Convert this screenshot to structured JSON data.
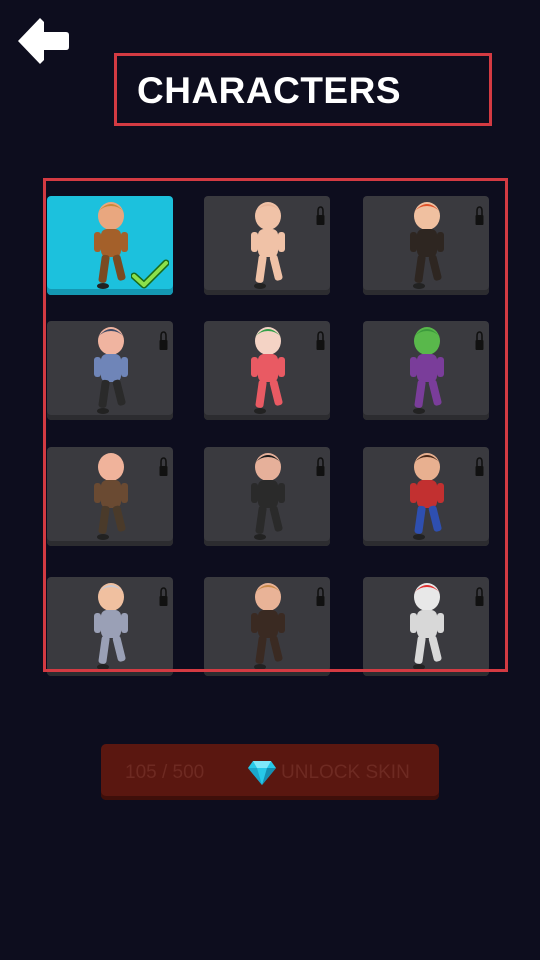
{
  "header": {
    "back_icon": "back-arrow-icon",
    "title": "CHARACTERS"
  },
  "characters": [
    {
      "name": "cowboy",
      "selected": true,
      "locked": false,
      "hair": "#c98a3a",
      "skin": "#e9a77f",
      "body": "#a4602a",
      "legs": "#7a4a22"
    },
    {
      "name": "baby",
      "selected": false,
      "locked": true,
      "hair": "#e9b69a",
      "skin": "#f0c2a7",
      "body": "#f0c2a7",
      "legs": "#f0c2a7"
    },
    {
      "name": "red-hair-agent",
      "selected": false,
      "locked": true,
      "hair": "#e0522a",
      "skin": "#f0c0a0",
      "body": "#2e2621",
      "legs": "#2e2621"
    },
    {
      "name": "police-officer",
      "selected": false,
      "locked": true,
      "hair": "#3f4a66",
      "skin": "#f0b4a0",
      "body": "#6f85b8",
      "legs": "#2a2a2a"
    },
    {
      "name": "joker",
      "selected": false,
      "locked": true,
      "hair": "#33a04a",
      "skin": "#f4d3c5",
      "body": "#e95a63",
      "legs": "#e95a63"
    },
    {
      "name": "green-giant",
      "selected": false,
      "locked": true,
      "hair": "#3c9a3c",
      "skin": "#59b84b",
      "body": "#7a3d9a",
      "legs": "#7a3d9a"
    },
    {
      "name": "bald-guy",
      "selected": false,
      "locked": true,
      "hair": "#f0b39b",
      "skin": "#f0b39b",
      "body": "#6a4a32",
      "legs": "#4a3a2a"
    },
    {
      "name": "hitman",
      "selected": false,
      "locked": true,
      "hair": "#1a1a1a",
      "skin": "#e6b09a",
      "body": "#2a2a2a",
      "legs": "#2a2a2a"
    },
    {
      "name": "wonder-hero",
      "selected": false,
      "locked": true,
      "hair": "#4a2a1a",
      "skin": "#e8b090",
      "body": "#c23030",
      "legs": "#2e4fb0"
    },
    {
      "name": "wizard",
      "selected": false,
      "locked": true,
      "hair": "#c9c9d3",
      "skin": "#f0c0a0",
      "body": "#9aa0b6",
      "legs": "#9aa0b6"
    },
    {
      "name": "suit-guy",
      "selected": false,
      "locked": true,
      "hair": "#c98a4a",
      "skin": "#e9b397",
      "body": "#3a2a22",
      "legs": "#3a2a22"
    },
    {
      "name": "knight",
      "selected": false,
      "locked": true,
      "hair": "#e03030",
      "skin": "#e8e8e8",
      "body": "#d8d8d8",
      "legs": "#d8d8d8"
    }
  ],
  "unlock": {
    "count": "105 / 500",
    "label": "UNLOCK SKIN",
    "gem_icon": "diamond-icon"
  },
  "colors": {
    "background": "#0d0d1e",
    "frame": "#d33a42",
    "selected_tile": "#1cc1dd",
    "tile": "#3a3a3f",
    "unlock_button": "#5a1710"
  }
}
